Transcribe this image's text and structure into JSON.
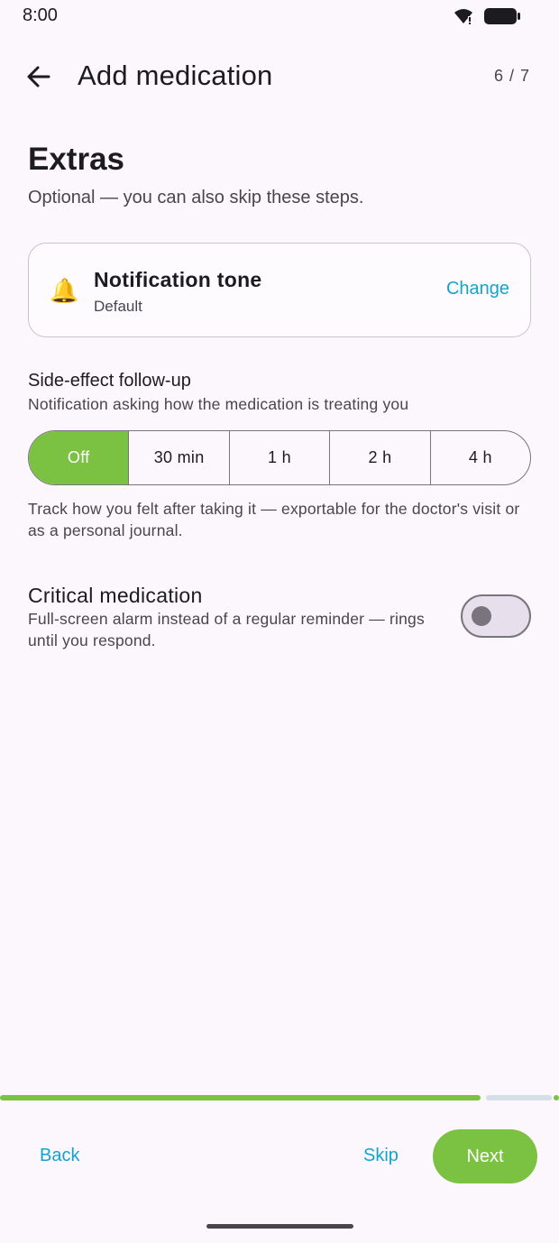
{
  "status_bar": {
    "time": "8:00",
    "icons": [
      "wifi-icon",
      "battery-icon"
    ]
  },
  "header": {
    "back_icon": "arrow-left-icon",
    "title": "Add medication",
    "step": "6 / 7"
  },
  "section": {
    "title": "Extras",
    "subtitle": "Optional — you can also skip these steps."
  },
  "notification_tone": {
    "icon": "bell-icon",
    "icon_glyph": "🔔",
    "title": "Notification tone",
    "value": "Default",
    "change_label": "Change"
  },
  "side_effect": {
    "title": "Side-effect follow-up",
    "subtitle": "Notification asking how the medication is treating you",
    "options": [
      "Off",
      "30 min",
      "1 h",
      "2 h",
      "4 h"
    ],
    "selected": "Off",
    "note": "Track how you felt after taking it — exportable for the doctor's visit or as a personal journal."
  },
  "critical": {
    "title": "Critical medication",
    "description": "Full-screen alarm instead of a regular reminder — rings until you respond.",
    "enabled": false
  },
  "progress": {
    "current_step": 6,
    "total_steps": 7,
    "fraction": 0.86
  },
  "footer": {
    "back_label": "Back",
    "skip_label": "Skip",
    "next_label": "Next"
  },
  "colors": {
    "accent_green": "#7cc242",
    "link_blue": "#12a4cf",
    "background": "#fcf7fc"
  }
}
